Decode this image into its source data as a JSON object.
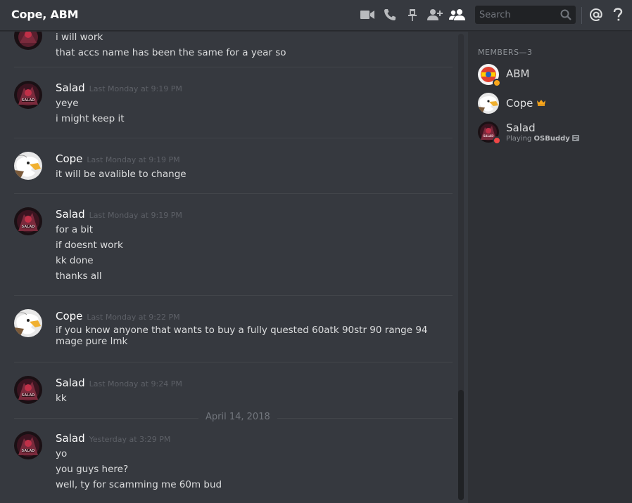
{
  "header": {
    "title": "Cope, ABM",
    "search_placeholder": "Search"
  },
  "colors": {
    "background": "#36393f",
    "sidebar": "#2f3136",
    "idle": "#faa61a",
    "dnd": "#f04747",
    "owner_crown": "#faa61a"
  },
  "messages": [
    {
      "author": "",
      "timestamp": "",
      "lines": [
        "i will work",
        "that accs name has been the same for a year so"
      ]
    },
    {
      "author": "Salad",
      "timestamp": "Last Monday at 9:19 PM",
      "lines": [
        "yeye",
        "i might keep it"
      ]
    },
    {
      "author": "Cope",
      "timestamp": "Last Monday at 9:19 PM",
      "lines": [
        "it will be avalible to change"
      ]
    },
    {
      "author": "Salad",
      "timestamp": "Last Monday at 9:19 PM",
      "lines": [
        "for a bit",
        "if doesnt work",
        "kk done",
        "thanks all"
      ]
    },
    {
      "author": "Cope",
      "timestamp": "Last Monday at 9:22 PM",
      "lines": [
        "if you know anyone that wants to buy a fully quested 60atk 90str 90 range 94",
        "mage pure lmk"
      ]
    },
    {
      "author": "Salad",
      "timestamp": "Last Monday at 9:24 PM",
      "lines": [
        "kk"
      ]
    },
    {
      "author": "Salad",
      "timestamp": "Yesterday at 3:29 PM",
      "lines": [
        "yo",
        "you guys here?",
        "well, ty for scamming me 60m bud"
      ]
    }
  ],
  "date_divider": "April 14, 2018",
  "members": {
    "header": "MEMBERS—3",
    "list": [
      {
        "name": "ABM",
        "status": "idle",
        "activity_prefix": "",
        "activity_game": ""
      },
      {
        "name": "Cope",
        "status": "online",
        "owner": true,
        "activity_prefix": "",
        "activity_game": ""
      },
      {
        "name": "Salad",
        "status": "dnd",
        "activity_prefix": "Playing",
        "activity_game": "OSBuddy"
      }
    ]
  },
  "icons": [
    "video-call-icon",
    "voice-call-icon",
    "pin-icon",
    "add-friend-icon",
    "member-list-icon",
    "search-icon",
    "mention-icon",
    "help-icon",
    "crown-icon",
    "rich-presence-icon"
  ]
}
